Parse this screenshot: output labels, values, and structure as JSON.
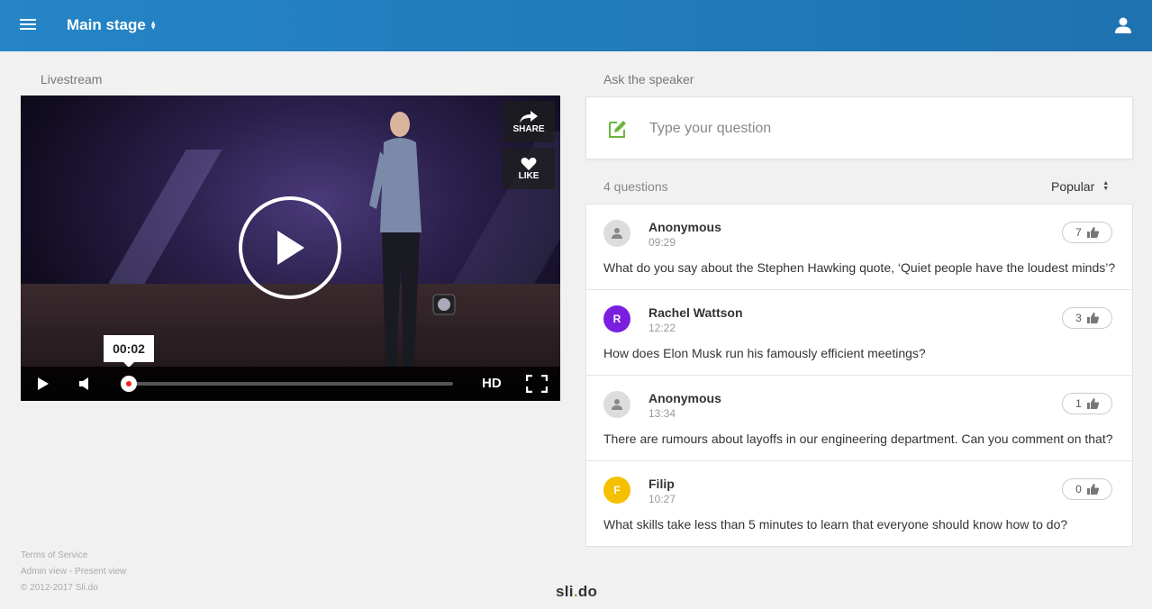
{
  "header": {
    "stage_title": "Main stage"
  },
  "livestream": {
    "label": "Livestream",
    "share_label": "SHARE",
    "like_label": "LIKE",
    "time_tooltip": "00:02",
    "hd_label": "HD",
    "progress": 0.0
  },
  "ask": {
    "label": "Ask the speaker",
    "placeholder": "Type your question"
  },
  "questions": {
    "count_label": "4 questions",
    "sort_label": "Popular",
    "items": [
      {
        "name": "Anonymous",
        "time": "09:29",
        "text": "What do you say about the Stephen Hawking quote, ‘Quiet people have the loudest minds’?",
        "likes": "7",
        "initial": "",
        "avatar_color": "#dddddd"
      },
      {
        "name": "Rachel Wattson",
        "time": "12:22",
        "text": "How does Elon Musk run his famously efficient meetings?",
        "likes": "3",
        "initial": "R",
        "avatar_color": "#7a1fe0"
      },
      {
        "name": "Anonymous",
        "time": "13:34",
        "text": "There are rumours about layoffs in our engineering department. Can you comment on that?",
        "likes": "1",
        "initial": "",
        "avatar_color": "#dddddd"
      },
      {
        "name": "Filip",
        "time": "10:27",
        "text": "What skills take less than 5 minutes to learn that everyone should know how to do?",
        "likes": "0",
        "initial": "F",
        "avatar_color": "#f5c000"
      }
    ]
  },
  "footer": {
    "terms": "Terms of Service",
    "admin_view": "Admin view",
    "separator": " - ",
    "present_view": "Present view",
    "copyright": "© 2012-2017 Sli.do",
    "logo_left": "sli",
    "logo_dot": ".",
    "logo_right": "do"
  },
  "colors": {
    "brand": "#2585c6",
    "accent_green": "#6bb53d"
  }
}
